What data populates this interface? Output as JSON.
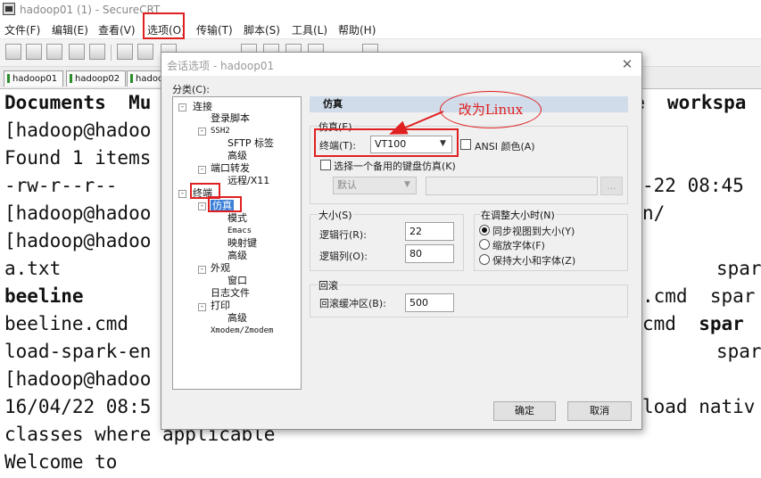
{
  "window": {
    "title": "hadoop01 (1) - SecureCRT"
  },
  "menu": [
    "文件(F)",
    "编辑(E)",
    "查看(V)",
    "选项(O)",
    "传输(T)",
    "脚本(S)",
    "工具(L)",
    "帮助(H)"
  ],
  "toolbar_icons": [
    "connect-icon",
    "quick-connect-icon",
    "connect-in-tab-icon",
    "reconnect-icon",
    "disconnect-icon",
    "copy-icon",
    "paste-icon",
    "find-icon",
    "print-icon",
    "sftp-icon",
    "settings-icon",
    "keymap-icon",
    "help-icon"
  ],
  "session_tabs": [
    "hadoop01",
    "hadoop02",
    "hadoo"
  ],
  "terminal": {
    "lines": [
      {
        "left": "Documents  Mu",
        "right": "e  workspa",
        "bold": true
      },
      {
        "left": "[hadoop@hadoo",
        "right": ""
      },
      {
        "left": "Found 1 items",
        "right": ""
      },
      {
        "left": "-rw-r--r--",
        "right": "-22 08:45"
      },
      {
        "left": "[hadoop@hadoo",
        "right": "n/"
      },
      {
        "left": "[hadoop@hadoo",
        "right": ""
      },
      {
        "left": "a.txt",
        "right": "spar"
      },
      {
        "left": "beeline",
        "right": ".cmd  spar",
        "bold": true
      },
      {
        "left": "beeline.cmd",
        "right": "cmd  spar",
        "right_bold": "spar"
      },
      {
        "left": "load-spark-en",
        "right": "spar"
      },
      {
        "left": "[hadoop@hadoo",
        "right": ""
      },
      {
        "left": "16/04/22 08:5",
        "right": "load nativ"
      },
      {
        "left": "classes where applicable",
        "right": ""
      },
      {
        "left": "Welcome to",
        "right": ""
      }
    ]
  },
  "dialog": {
    "title": "会话选项 - hadoop01",
    "close_glyph": "✕",
    "category_label": "分类(C):",
    "tree": [
      {
        "label": "连接",
        "level": 0,
        "toggle": "-"
      },
      {
        "label": "登录脚本",
        "level": 1
      },
      {
        "label": "SSH2",
        "level": 1,
        "toggle": "-",
        "mono": true
      },
      {
        "label": "SFTP 标签",
        "level": 2
      },
      {
        "label": "高级",
        "level": 2
      },
      {
        "label": "端口转发",
        "level": 1,
        "toggle": "-"
      },
      {
        "label": "远程/X11",
        "level": 2
      },
      {
        "label": "终端",
        "level": 0,
        "toggle": "-"
      },
      {
        "label": "仿真",
        "level": 1,
        "toggle": "-",
        "selected": true
      },
      {
        "label": "模式",
        "level": 2
      },
      {
        "label": "Emacs",
        "level": 2,
        "mono": true
      },
      {
        "label": "映射键",
        "level": 2
      },
      {
        "label": "高级",
        "level": 2
      },
      {
        "label": "外观",
        "level": 1,
        "toggle": "-"
      },
      {
        "label": "窗口",
        "level": 2
      },
      {
        "label": "日志文件",
        "level": 1
      },
      {
        "label": "打印",
        "level": 1,
        "toggle": "-"
      },
      {
        "label": "高级",
        "level": 2
      },
      {
        "label": "Xmodem/Zmodem",
        "level": 1,
        "mono": true
      }
    ],
    "page_header": "仿真",
    "emulation": {
      "group_title": "仿真(E)",
      "terminal_label": "终端(T):",
      "terminal_value": "VT100",
      "ansi_color_label": "ANSI 颜色(A)",
      "ansi_color_checked": false,
      "alt_keyboard_label": "选择一个备用的键盘仿真(K)",
      "alt_keyboard_checked": false,
      "alt_keyboard_value": "默认",
      "browse_label": "..."
    },
    "size": {
      "group_title": "大小(S)",
      "rows_label": "逻辑行(R):",
      "rows_value": "22",
      "cols_label": "逻辑列(O):",
      "cols_value": "80"
    },
    "on_resize": {
      "group_title": "在调整大小时(N)",
      "options": [
        "同步视图到大小(Y)",
        "缩放字体(F)",
        "保持大小和字体(Z)"
      ],
      "selected_index": 0
    },
    "scrollback": {
      "group_title": "回滚",
      "buffer_label": "回滚缓冲区(B):",
      "buffer_value": "500"
    },
    "ok_label": "确定",
    "cancel_label": "取消"
  },
  "annotation": {
    "text": "改为Linux",
    "color": "#e02020"
  }
}
